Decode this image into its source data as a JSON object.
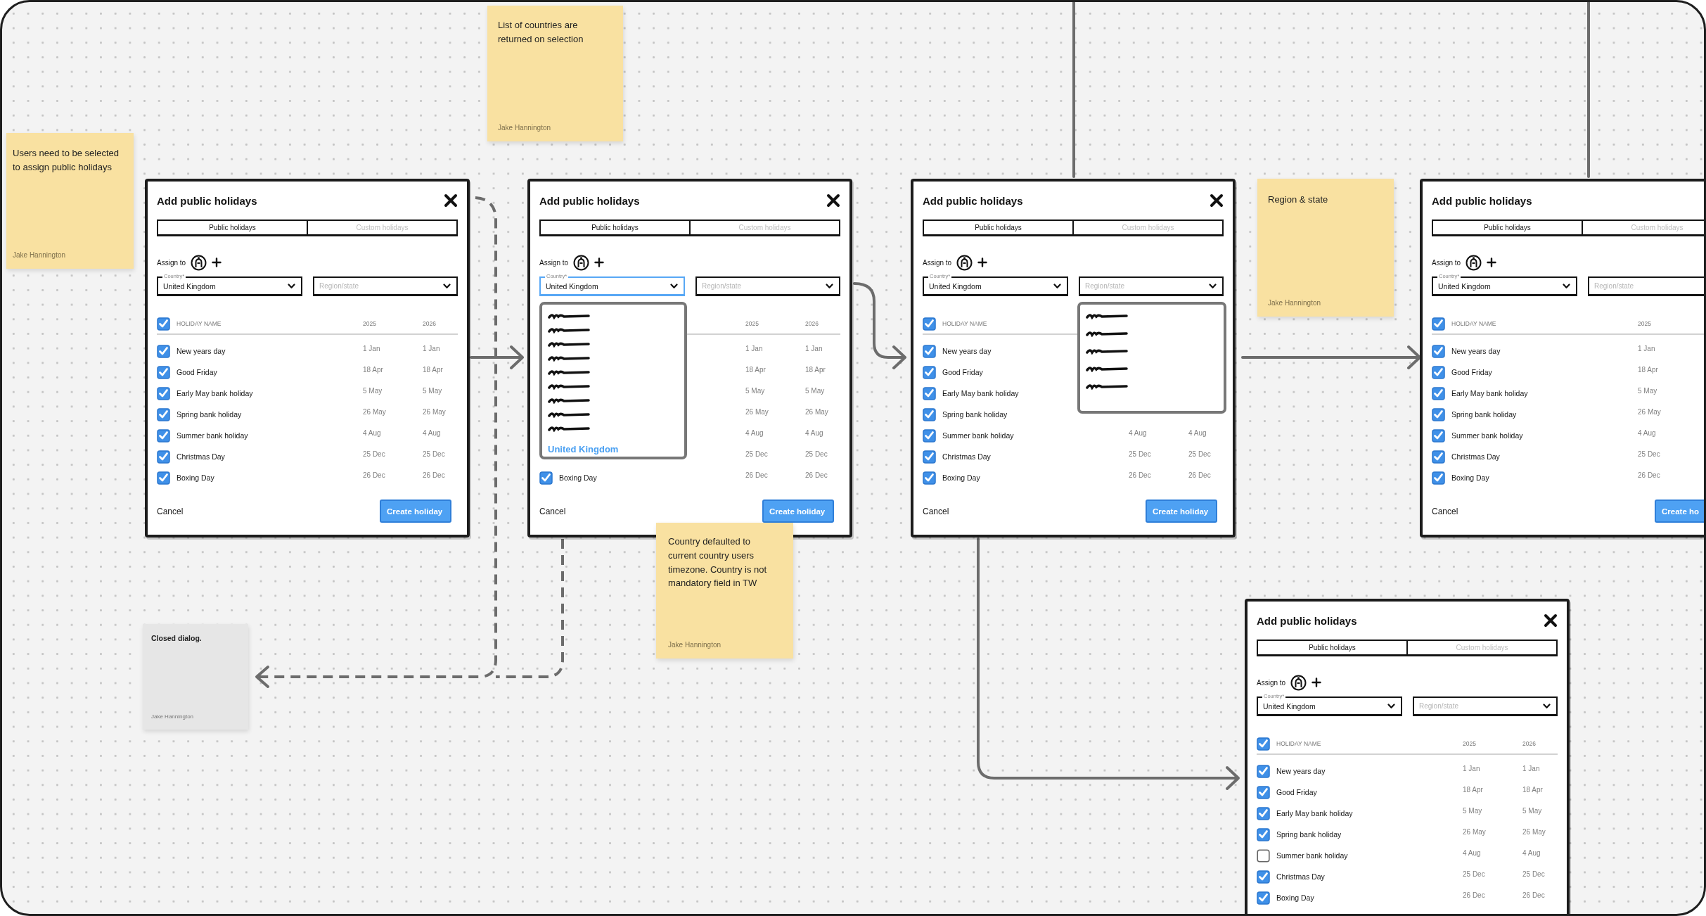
{
  "notes": [
    {
      "kind": "sticky",
      "text": "Users need to be selected to assign public holidays",
      "author": "Jake Hannington"
    },
    {
      "kind": "sticky",
      "text": "List of countries are returned on selection",
      "author": "Jake Hannington"
    },
    {
      "kind": "sticky",
      "text": "Region & state",
      "author": "Jake Hannington"
    },
    {
      "kind": "sticky",
      "text": "Country defaulted to current country users timezone. Country is not mandatory field in TW",
      "author": "Jake Hannington"
    },
    {
      "kind": "comment",
      "text": "Closed dialog.",
      "author": "Jake Hannington"
    }
  ],
  "dialogs": [
    {
      "title": "Add public holidays",
      "tabs": [
        {
          "label": "Public holidays",
          "selected": true
        },
        {
          "label": "Custom holidays",
          "selected": false
        }
      ],
      "assign_label": "Assign to",
      "country": {
        "label": "Country*",
        "value": "United Kingdom",
        "focused": false
      },
      "region": {
        "placeholder": "Region/state",
        "focused": false
      },
      "header": {
        "checked": true,
        "name": "HOLIDAY NAME",
        "years": [
          "2025",
          "2026"
        ]
      },
      "rows": [
        {
          "name": "New years day",
          "checked": true,
          "dates": [
            "1 Jan",
            "1 Jan"
          ]
        },
        {
          "name": "Good Friday",
          "checked": true,
          "dates": [
            "18 Apr",
            "18 Apr"
          ]
        },
        {
          "name": "Early May bank holiday",
          "checked": true,
          "dates": [
            "5 May",
            "5 May"
          ]
        },
        {
          "name": "Spring bank holiday",
          "checked": true,
          "dates": [
            "26 May",
            "26 May"
          ]
        },
        {
          "name": "Summer bank holiday",
          "checked": true,
          "dates": [
            "4 Aug",
            "4 Aug"
          ]
        },
        {
          "name": "Christmas Day",
          "checked": true,
          "dates": [
            "25 Dec",
            "25 Dec"
          ]
        },
        {
          "name": "Boxing Day",
          "checked": true,
          "dates": [
            "26 Dec",
            "26 Dec"
          ]
        }
      ],
      "cancel": "Cancel",
      "submit": "Create holiday"
    },
    {
      "title": "Add public holidays",
      "tabs": [
        {
          "label": "Public holidays",
          "selected": true
        },
        {
          "label": "Custom holidays",
          "selected": false
        }
      ],
      "assign_label": "Assign to",
      "country": {
        "label": "Country*",
        "value": "United Kingdom",
        "focused": true,
        "dropdown": {
          "options": [
            {
              "kind": "scribble"
            },
            {
              "kind": "scribble"
            },
            {
              "kind": "scribble"
            },
            {
              "kind": "scribble"
            },
            {
              "kind": "scribble"
            },
            {
              "kind": "scribble"
            },
            {
              "kind": "scribble"
            },
            {
              "kind": "scribble"
            },
            {
              "kind": "scribble"
            },
            {
              "kind": "text",
              "label": "United Kingdom",
              "selected": true
            }
          ]
        }
      },
      "region": {
        "placeholder": "Region/state",
        "focused": false
      },
      "header": {
        "years": [
          "2025",
          "2026"
        ]
      },
      "rows": [
        {
          "dates": [
            "1 Jan",
            "1 Jan"
          ]
        },
        {
          "dates": [
            "18 Apr",
            "18 Apr"
          ]
        },
        {
          "dates": [
            "5 May",
            "5 May"
          ]
        },
        {
          "dates": [
            "26 May",
            "26 May"
          ]
        },
        {
          "dates": [
            "4 Aug",
            "4 Aug"
          ]
        },
        {
          "dates": [
            "25 Dec",
            "25 Dec"
          ]
        },
        {
          "name": "Boxing Day",
          "checked": true,
          "dates": [
            "26 Dec",
            "26 Dec"
          ]
        }
      ],
      "cancel": "Cancel",
      "submit": "Create holiday"
    },
    {
      "title": "Add public holidays",
      "tabs": [
        {
          "label": "Public holidays",
          "selected": true
        },
        {
          "label": "Custom holidays",
          "selected": false
        }
      ],
      "assign_label": "Assign to",
      "country": {
        "label": "Country*",
        "value": "United Kingdom",
        "focused": false
      },
      "region": {
        "placeholder": "Region/state",
        "focused": false,
        "dropdown": {
          "options": [
            {
              "kind": "scribble"
            },
            {
              "kind": "scribble"
            },
            {
              "kind": "scribble"
            },
            {
              "kind": "scribble"
            },
            {
              "kind": "scribble"
            }
          ]
        }
      },
      "header": {
        "checked": true,
        "name": "HOLIDAY NAME"
      },
      "rows": [
        {
          "name": "New years day",
          "checked": true
        },
        {
          "name": "Good Friday",
          "checked": true
        },
        {
          "name": "Early May bank holiday",
          "checked": true
        },
        {
          "name": "Spring bank holiday",
          "checked": true
        },
        {
          "name": "Summer bank holiday",
          "checked": true,
          "dates": [
            "4 Aug",
            "4 Aug"
          ]
        },
        {
          "name": "Christmas Day",
          "checked": true,
          "dates": [
            "25 Dec",
            "25 Dec"
          ]
        },
        {
          "name": "Boxing Day",
          "checked": true,
          "dates": [
            "26 Dec",
            "26 Dec"
          ]
        }
      ],
      "cancel": "Cancel",
      "submit": "Create holiday"
    },
    {
      "title": "Add public holidays",
      "tabs": [
        {
          "label": "Public holidays",
          "selected": true
        },
        {
          "label": "Custom holidays",
          "selected": false
        }
      ],
      "assign_label": "Assign to",
      "country": {
        "label": "Country*",
        "value": "United Kingdom",
        "focused": false
      },
      "region": {
        "placeholder": "Region/state",
        "focused": false
      },
      "header": {
        "checked": true,
        "name": "HOLIDAY NAME",
        "years": [
          "2025"
        ]
      },
      "rows": [
        {
          "name": "New years day",
          "checked": true,
          "dates": [
            "1 Jan"
          ]
        },
        {
          "name": "Good Friday",
          "checked": true,
          "dates": [
            "18 Apr"
          ]
        },
        {
          "name": "Early May bank holiday",
          "checked": true,
          "dates": [
            "5 May"
          ]
        },
        {
          "name": "Spring bank holiday",
          "checked": true,
          "dates": [
            "26 May"
          ]
        },
        {
          "name": "Summer bank holiday",
          "checked": true,
          "dates": [
            "4 Aug"
          ]
        },
        {
          "name": "Christmas Day",
          "checked": true,
          "dates": [
            "25 Dec"
          ]
        },
        {
          "name": "Boxing Day",
          "checked": true,
          "dates": [
            "26 Dec"
          ]
        }
      ],
      "cancel": "Cancel",
      "submit": "Create ho"
    },
    {
      "title": "Add public holidays",
      "tabs": [
        {
          "label": "Public holidays",
          "selected": true
        },
        {
          "label": "Custom holidays",
          "selected": false
        }
      ],
      "assign_label": "Assign to",
      "country": {
        "label": "Country*",
        "value": "United Kingdom",
        "focused": false
      },
      "region": {
        "placeholder": "Region/state",
        "focused": false
      },
      "header": {
        "checked": true,
        "name": "HOLIDAY NAME",
        "years": [
          "2025",
          "2026"
        ]
      },
      "rows": [
        {
          "name": "New years day",
          "checked": true,
          "dates": [
            "1 Jan",
            "1 Jan"
          ]
        },
        {
          "name": "Good Friday",
          "checked": true,
          "dates": [
            "18 Apr",
            "18 Apr"
          ]
        },
        {
          "name": "Early May bank holiday",
          "checked": true,
          "dates": [
            "5 May",
            "5 May"
          ]
        },
        {
          "name": "Spring bank holiday",
          "checked": true,
          "dates": [
            "26 May",
            "26 May"
          ]
        },
        {
          "name": "Summer bank holiday",
          "checked": false,
          "dates": [
            "4 Aug",
            "4 Aug"
          ]
        },
        {
          "name": "Christmas Day",
          "checked": true,
          "dates": [
            "25 Dec",
            "25 Dec"
          ]
        },
        {
          "name": "Boxing Day",
          "checked": true,
          "dates": [
            "26 Dec",
            "26 Dec"
          ]
        }
      ]
    }
  ]
}
